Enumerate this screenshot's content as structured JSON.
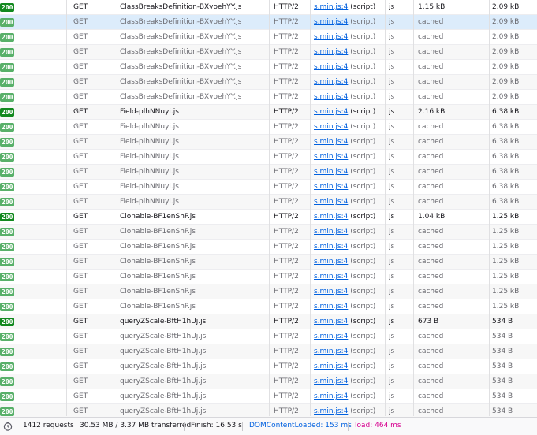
{
  "requests": [
    {
      "status": "200",
      "method": "GET",
      "file": "ClassBreaksDefinition-BXvoehYY.js",
      "protocol": "HTTP/2",
      "initiator_link": "s.min.js:4",
      "initiator_type": "(script)",
      "type": "js",
      "transferred": "1.15 kB",
      "size": "2.09 kB",
      "cached": false,
      "selected": false
    },
    {
      "status": "200",
      "method": "GET",
      "file": "ClassBreaksDefinition-BXvoehYY.js",
      "protocol": "HTTP/2",
      "initiator_link": "s.min.js:4",
      "initiator_type": "(script)",
      "type": "js",
      "transferred": "cached",
      "size": "2.09 kB",
      "cached": true,
      "selected": true
    },
    {
      "status": "200",
      "method": "GET",
      "file": "ClassBreaksDefinition-BXvoehYY.js",
      "protocol": "HTTP/2",
      "initiator_link": "s.min.js:4",
      "initiator_type": "(script)",
      "type": "js",
      "transferred": "cached",
      "size": "2.09 kB",
      "cached": true,
      "selected": false
    },
    {
      "status": "200",
      "method": "GET",
      "file": "ClassBreaksDefinition-BXvoehYY.js",
      "protocol": "HTTP/2",
      "initiator_link": "s.min.js:4",
      "initiator_type": "(script)",
      "type": "js",
      "transferred": "cached",
      "size": "2.09 kB",
      "cached": true,
      "selected": false
    },
    {
      "status": "200",
      "method": "GET",
      "file": "ClassBreaksDefinition-BXvoehYY.js",
      "protocol": "HTTP/2",
      "initiator_link": "s.min.js:4",
      "initiator_type": "(script)",
      "type": "js",
      "transferred": "cached",
      "size": "2.09 kB",
      "cached": true,
      "selected": false
    },
    {
      "status": "200",
      "method": "GET",
      "file": "ClassBreaksDefinition-BXvoehYY.js",
      "protocol": "HTTP/2",
      "initiator_link": "s.min.js:4",
      "initiator_type": "(script)",
      "type": "js",
      "transferred": "cached",
      "size": "2.09 kB",
      "cached": true,
      "selected": false
    },
    {
      "status": "200",
      "method": "GET",
      "file": "ClassBreaksDefinition-BXvoehYY.js",
      "protocol": "HTTP/2",
      "initiator_link": "s.min.js:4",
      "initiator_type": "(script)",
      "type": "js",
      "transferred": "cached",
      "size": "2.09 kB",
      "cached": true,
      "selected": false
    },
    {
      "status": "200",
      "method": "GET",
      "file": "Field-plhNNuyi.js",
      "protocol": "HTTP/2",
      "initiator_link": "s.min.js:4",
      "initiator_type": "(script)",
      "type": "js",
      "transferred": "2.16 kB",
      "size": "6.38 kB",
      "cached": false,
      "selected": false
    },
    {
      "status": "200",
      "method": "GET",
      "file": "Field-plhNNuyi.js",
      "protocol": "HTTP/2",
      "initiator_link": "s.min.js:4",
      "initiator_type": "(script)",
      "type": "js",
      "transferred": "cached",
      "size": "6.38 kB",
      "cached": true,
      "selected": false
    },
    {
      "status": "200",
      "method": "GET",
      "file": "Field-plhNNuyi.js",
      "protocol": "HTTP/2",
      "initiator_link": "s.min.js:4",
      "initiator_type": "(script)",
      "type": "js",
      "transferred": "cached",
      "size": "6.38 kB",
      "cached": true,
      "selected": false
    },
    {
      "status": "200",
      "method": "GET",
      "file": "Field-plhNNuyi.js",
      "protocol": "HTTP/2",
      "initiator_link": "s.min.js:4",
      "initiator_type": "(script)",
      "type": "js",
      "transferred": "cached",
      "size": "6.38 kB",
      "cached": true,
      "selected": false
    },
    {
      "status": "200",
      "method": "GET",
      "file": "Field-plhNNuyi.js",
      "protocol": "HTTP/2",
      "initiator_link": "s.min.js:4",
      "initiator_type": "(script)",
      "type": "js",
      "transferred": "cached",
      "size": "6.38 kB",
      "cached": true,
      "selected": false
    },
    {
      "status": "200",
      "method": "GET",
      "file": "Field-plhNNuyi.js",
      "protocol": "HTTP/2",
      "initiator_link": "s.min.js:4",
      "initiator_type": "(script)",
      "type": "js",
      "transferred": "cached",
      "size": "6.38 kB",
      "cached": true,
      "selected": false
    },
    {
      "status": "200",
      "method": "GET",
      "file": "Field-plhNNuyi.js",
      "protocol": "HTTP/2",
      "initiator_link": "s.min.js:4",
      "initiator_type": "(script)",
      "type": "js",
      "transferred": "cached",
      "size": "6.38 kB",
      "cached": true,
      "selected": false
    },
    {
      "status": "200",
      "method": "GET",
      "file": "Clonable-BF1enShP.js",
      "protocol": "HTTP/2",
      "initiator_link": "s.min.js:4",
      "initiator_type": "(script)",
      "type": "js",
      "transferred": "1.04 kB",
      "size": "1.25 kB",
      "cached": false,
      "selected": false
    },
    {
      "status": "200",
      "method": "GET",
      "file": "Clonable-BF1enShP.js",
      "protocol": "HTTP/2",
      "initiator_link": "s.min.js:4",
      "initiator_type": "(script)",
      "type": "js",
      "transferred": "cached",
      "size": "1.25 kB",
      "cached": true,
      "selected": false
    },
    {
      "status": "200",
      "method": "GET",
      "file": "Clonable-BF1enShP.js",
      "protocol": "HTTP/2",
      "initiator_link": "s.min.js:4",
      "initiator_type": "(script)",
      "type": "js",
      "transferred": "cached",
      "size": "1.25 kB",
      "cached": true,
      "selected": false
    },
    {
      "status": "200",
      "method": "GET",
      "file": "Clonable-BF1enShP.js",
      "protocol": "HTTP/2",
      "initiator_link": "s.min.js:4",
      "initiator_type": "(script)",
      "type": "js",
      "transferred": "cached",
      "size": "1.25 kB",
      "cached": true,
      "selected": false
    },
    {
      "status": "200",
      "method": "GET",
      "file": "Clonable-BF1enShP.js",
      "protocol": "HTTP/2",
      "initiator_link": "s.min.js:4",
      "initiator_type": "(script)",
      "type": "js",
      "transferred": "cached",
      "size": "1.25 kB",
      "cached": true,
      "selected": false
    },
    {
      "status": "200",
      "method": "GET",
      "file": "Clonable-BF1enShP.js",
      "protocol": "HTTP/2",
      "initiator_link": "s.min.js:4",
      "initiator_type": "(script)",
      "type": "js",
      "transferred": "cached",
      "size": "1.25 kB",
      "cached": true,
      "selected": false
    },
    {
      "status": "200",
      "method": "GET",
      "file": "Clonable-BF1enShP.js",
      "protocol": "HTTP/2",
      "initiator_link": "s.min.js:4",
      "initiator_type": "(script)",
      "type": "js",
      "transferred": "cached",
      "size": "1.25 kB",
      "cached": true,
      "selected": false
    },
    {
      "status": "200",
      "method": "GET",
      "file": "queryZScale-BftH1hUj.js",
      "protocol": "HTTP/2",
      "initiator_link": "s.min.js:4",
      "initiator_type": "(script)",
      "type": "js",
      "transferred": "673 B",
      "size": "534 B",
      "cached": false,
      "selected": false
    },
    {
      "status": "200",
      "method": "GET",
      "file": "queryZScale-BftH1hUj.js",
      "protocol": "HTTP/2",
      "initiator_link": "s.min.js:4",
      "initiator_type": "(script)",
      "type": "js",
      "transferred": "cached",
      "size": "534 B",
      "cached": true,
      "selected": false
    },
    {
      "status": "200",
      "method": "GET",
      "file": "queryZScale-BftH1hUj.js",
      "protocol": "HTTP/2",
      "initiator_link": "s.min.js:4",
      "initiator_type": "(script)",
      "type": "js",
      "transferred": "cached",
      "size": "534 B",
      "cached": true,
      "selected": false
    },
    {
      "status": "200",
      "method": "GET",
      "file": "queryZScale-BftH1hUj.js",
      "protocol": "HTTP/2",
      "initiator_link": "s.min.js:4",
      "initiator_type": "(script)",
      "type": "js",
      "transferred": "cached",
      "size": "534 B",
      "cached": true,
      "selected": false
    },
    {
      "status": "200",
      "method": "GET",
      "file": "queryZScale-BftH1hUj.js",
      "protocol": "HTTP/2",
      "initiator_link": "s.min.js:4",
      "initiator_type": "(script)",
      "type": "js",
      "transferred": "cached",
      "size": "534 B",
      "cached": true,
      "selected": false
    },
    {
      "status": "200",
      "method": "GET",
      "file": "queryZScale-BftH1hUj.js",
      "protocol": "HTTP/2",
      "initiator_link": "s.min.js:4",
      "initiator_type": "(script)",
      "type": "js",
      "transferred": "cached",
      "size": "534 B",
      "cached": true,
      "selected": false
    },
    {
      "status": "200",
      "method": "GET",
      "file": "queryZScale-BftH1hUj.js",
      "protocol": "HTTP/2",
      "initiator_link": "s.min.js:4",
      "initiator_type": "(script)",
      "type": "js",
      "transferred": "cached",
      "size": "534 B",
      "cached": true,
      "selected": false
    }
  ],
  "statusbar": {
    "icon": "clock-icon",
    "requests": "1412 requests",
    "transferred": "30.53 MB / 3.37 MB transferred",
    "finish": "Finish: 16.53 s",
    "dom_content_loaded": "DOMContentLoaded: 153 ms",
    "load": "load: 464 ms"
  },
  "colors": {
    "status_ok": "#12891f",
    "status_ok_cached": "#58b069",
    "link": "#0060df",
    "selected_row": "#dcecfb",
    "dom_content_loaded": "#0060df",
    "load": "#d7008f"
  }
}
